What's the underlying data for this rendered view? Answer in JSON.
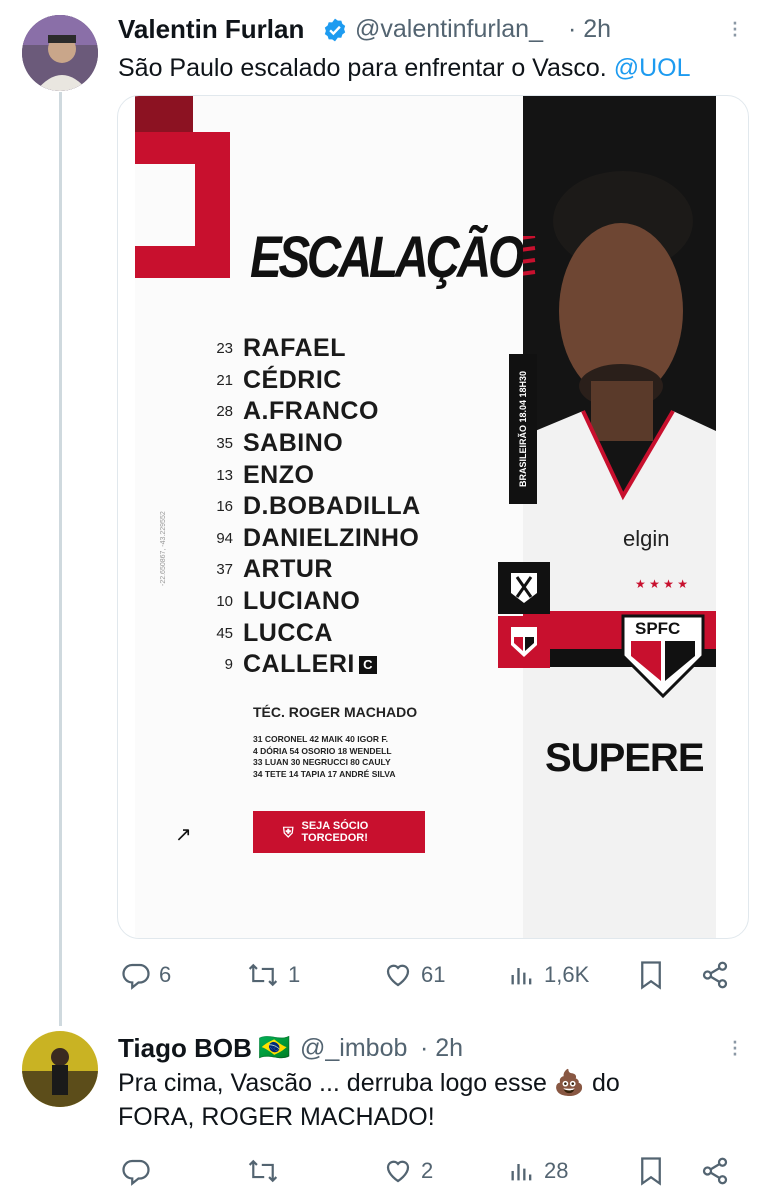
{
  "tweet": {
    "author_name": "Valentin Furlan",
    "handle": "@valentinfurlan_",
    "time": "· 2h",
    "text": "São Paulo escalado para enfrentar o Vasco.",
    "mention": "@UOL",
    "verified": true,
    "image": {
      "title": "ESCALAÇÃO",
      "lineup": [
        {
          "number": "23",
          "name": "RAFAEL"
        },
        {
          "number": "21",
          "name": "CÉDRIC"
        },
        {
          "number": "28",
          "name": "A.FRANCO"
        },
        {
          "number": "35",
          "name": "SABINO"
        },
        {
          "number": "13",
          "name": "ENZO"
        },
        {
          "number": "16",
          "name": "D.BOBADILLA"
        },
        {
          "number": "94",
          "name": "DANIELZINHO"
        },
        {
          "number": "37",
          "name": "ARTUR"
        },
        {
          "number": "10",
          "name": "LUCIANO"
        },
        {
          "number": "45",
          "name": "LUCCA"
        },
        {
          "number": "9",
          "name": "CALLERI"
        }
      ],
      "captain_badge": "C",
      "coach": "TÉC. ROGER MACHADO",
      "bench": [
        "31 CORONEL 42 MAIK 40 IGOR F.",
        "4 DÓRIA 54 OSORIO 18 WENDELL",
        "33 LUAN 30 NEGRUCCI 80 CAULY",
        "34 TETE 14 TAPIA 17 ANDRÉ SILVA"
      ],
      "cta_line1": "SEJA SÓCIO",
      "cta_line2": "TORCEDOR!",
      "side_banner": "BRASILEIRÃO 18.04 18H30",
      "coords_text": "-22.650867, -43.229552",
      "sponsor_chest": "elgin",
      "sponsor_front": "SUPERE",
      "crest_text": "SPFC",
      "colors": {
        "red": "#c8102e",
        "dark": "#0d0d0d"
      }
    },
    "actions": {
      "replies": "6",
      "retweets": "1",
      "likes": "61",
      "views": "1,6K"
    }
  },
  "reply": {
    "author_name": "Tiago BOB",
    "flag": "🇧🇷",
    "handle": "@_imbob",
    "time": "· 2h",
    "text_line1": "Pra cima, Vascão ... derruba logo esse",
    "emoji": "💩",
    "text_after_emoji": "do",
    "text_line2": "FORA, ROGER MACHADO!",
    "actions": {
      "replies": "",
      "retweets": "",
      "likes": "2",
      "views": "28"
    }
  }
}
